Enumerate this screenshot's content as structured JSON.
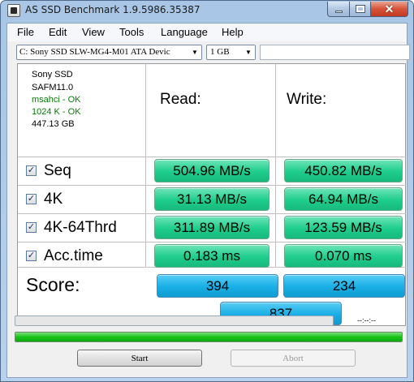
{
  "window": {
    "title": "AS SSD Benchmark 1.9.5986.35387",
    "minimize_glyph": "",
    "close_glyph": "✕"
  },
  "menu": {
    "items": [
      "File",
      "Edit",
      "View",
      "Tools",
      "Language",
      "Help"
    ]
  },
  "toolbar": {
    "drive": "C: Sony SSD SLW-MG4-M01 ATA Devic",
    "test_size": "1 GB",
    "dropdown_icon": "triangle-down-icon"
  },
  "drive_info": {
    "name": "Sony SSD",
    "firmware": "SAFM11.0",
    "driver_status": "msahci - OK",
    "alignment_status": "1024 K - OK",
    "capacity": "447.13 GB"
  },
  "columns": {
    "read": "Read:",
    "write": "Write:"
  },
  "tests": [
    {
      "label": "Seq",
      "checked": true,
      "read": "504.96 MB/s",
      "write": "450.82 MB/s"
    },
    {
      "label": "4K",
      "checked": true,
      "read": "31.13 MB/s",
      "write": "64.94 MB/s"
    },
    {
      "label": "4K-64Thrd",
      "checked": true,
      "read": "311.89 MB/s",
      "write": "123.59 MB/s"
    },
    {
      "label": "Acc.time",
      "checked": true,
      "read": "0.183 ms",
      "write": "0.070 ms"
    }
  ],
  "check_glyph": "✓",
  "score": {
    "label": "Score:",
    "read": "394",
    "write": "234",
    "total": "837"
  },
  "progress": {
    "test_progress": 0,
    "overall_progress": 100,
    "elapsed_time": "--:--:--"
  },
  "buttons": {
    "start": "Start",
    "abort": "Abort"
  },
  "colors": {
    "result_green": "#1ecd8c",
    "score_blue": "#18aee6",
    "progress_green": "#18c418",
    "ok_text": "#0a7a0a"
  }
}
